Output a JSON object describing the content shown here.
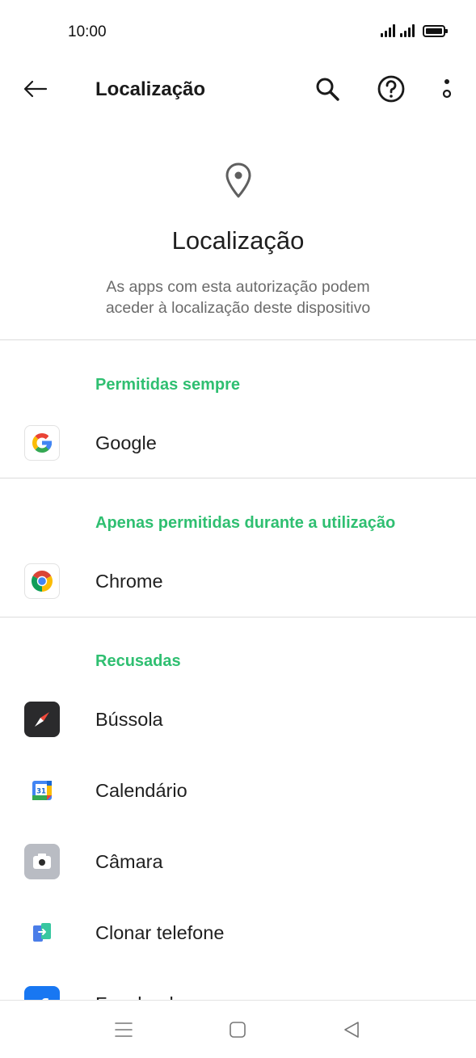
{
  "status_bar": {
    "time": "10:00"
  },
  "app_bar": {
    "title": "Localização"
  },
  "hero": {
    "title": "Localização",
    "description": "As apps com esta autorização podem\naceder à localização deste dispositivo"
  },
  "sections": [
    {
      "title": "Permitidas sempre",
      "apps": [
        {
          "label": "Google",
          "icon": "google-icon"
        }
      ]
    },
    {
      "title": "Apenas permitidas durante a utilização",
      "apps": [
        {
          "label": "Chrome",
          "icon": "chrome-icon"
        }
      ]
    },
    {
      "title": "Recusadas",
      "apps": [
        {
          "label": "Bússola",
          "icon": "compass-icon"
        },
        {
          "label": "Calendário",
          "icon": "calendar-icon"
        },
        {
          "label": "Câmara",
          "icon": "camera-icon"
        },
        {
          "label": "Clonar telefone",
          "icon": "clone-phone-icon"
        },
        {
          "label": "Facebook",
          "icon": "facebook-icon"
        }
      ]
    }
  ],
  "colors": {
    "section_header": "#2fbf71",
    "description": "#6b6b6b",
    "divider": "#dcdcdc"
  }
}
